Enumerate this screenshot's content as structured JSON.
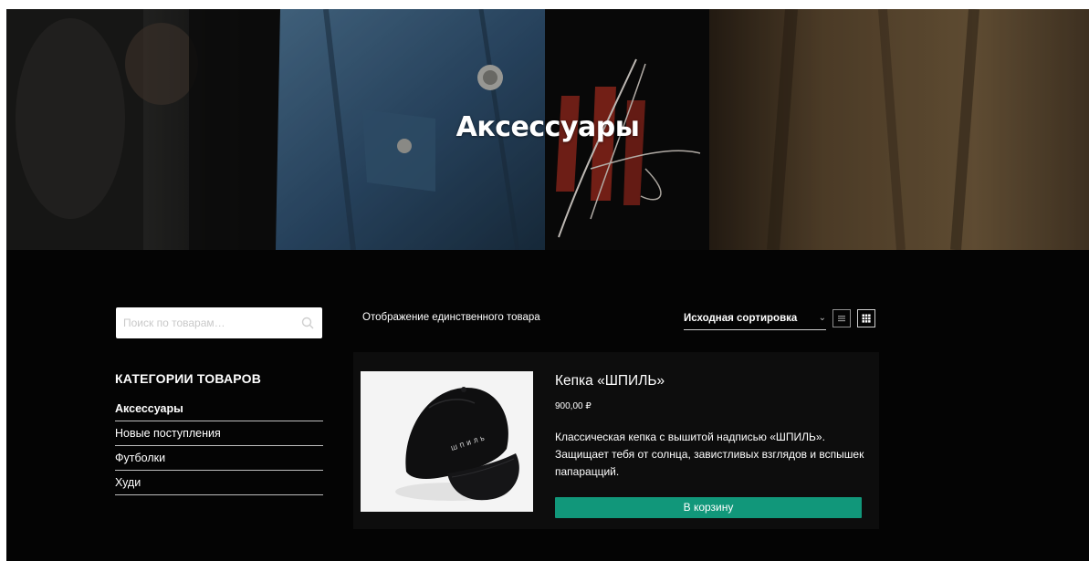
{
  "hero": {
    "title": "Аксессуары"
  },
  "search": {
    "placeholder": "Поиск по товарам…"
  },
  "categories": {
    "heading": "КАТЕГОРИИ ТОВАРОВ",
    "items": [
      {
        "label": "Аксессуары",
        "active": true
      },
      {
        "label": "Новые поступления",
        "active": false
      },
      {
        "label": "Футболки",
        "active": false
      },
      {
        "label": "Худи",
        "active": false
      }
    ]
  },
  "toolbar": {
    "result_count": "Отображение единственного товара",
    "sort_selected": "Исходная сортировка",
    "sort_chevron": "⌄",
    "view_list_icon": "list-view-icon",
    "view_grid_icon": "grid-view-icon"
  },
  "product": {
    "title": "Кепка «ШПИЛЬ»",
    "price": "900,00 ₽",
    "description": "Классическая кепка с вышитой надписью «ШПИЛЬ». Защищает тебя от солнца, завистливых взглядов и вспышек папарацций.",
    "button_label": "В корзину",
    "image_icon": "black-cap-image",
    "cap_text": "ШПИЛЬ"
  },
  "colors": {
    "background": "#040404",
    "button": "#11977a",
    "text": "#ffffff"
  }
}
